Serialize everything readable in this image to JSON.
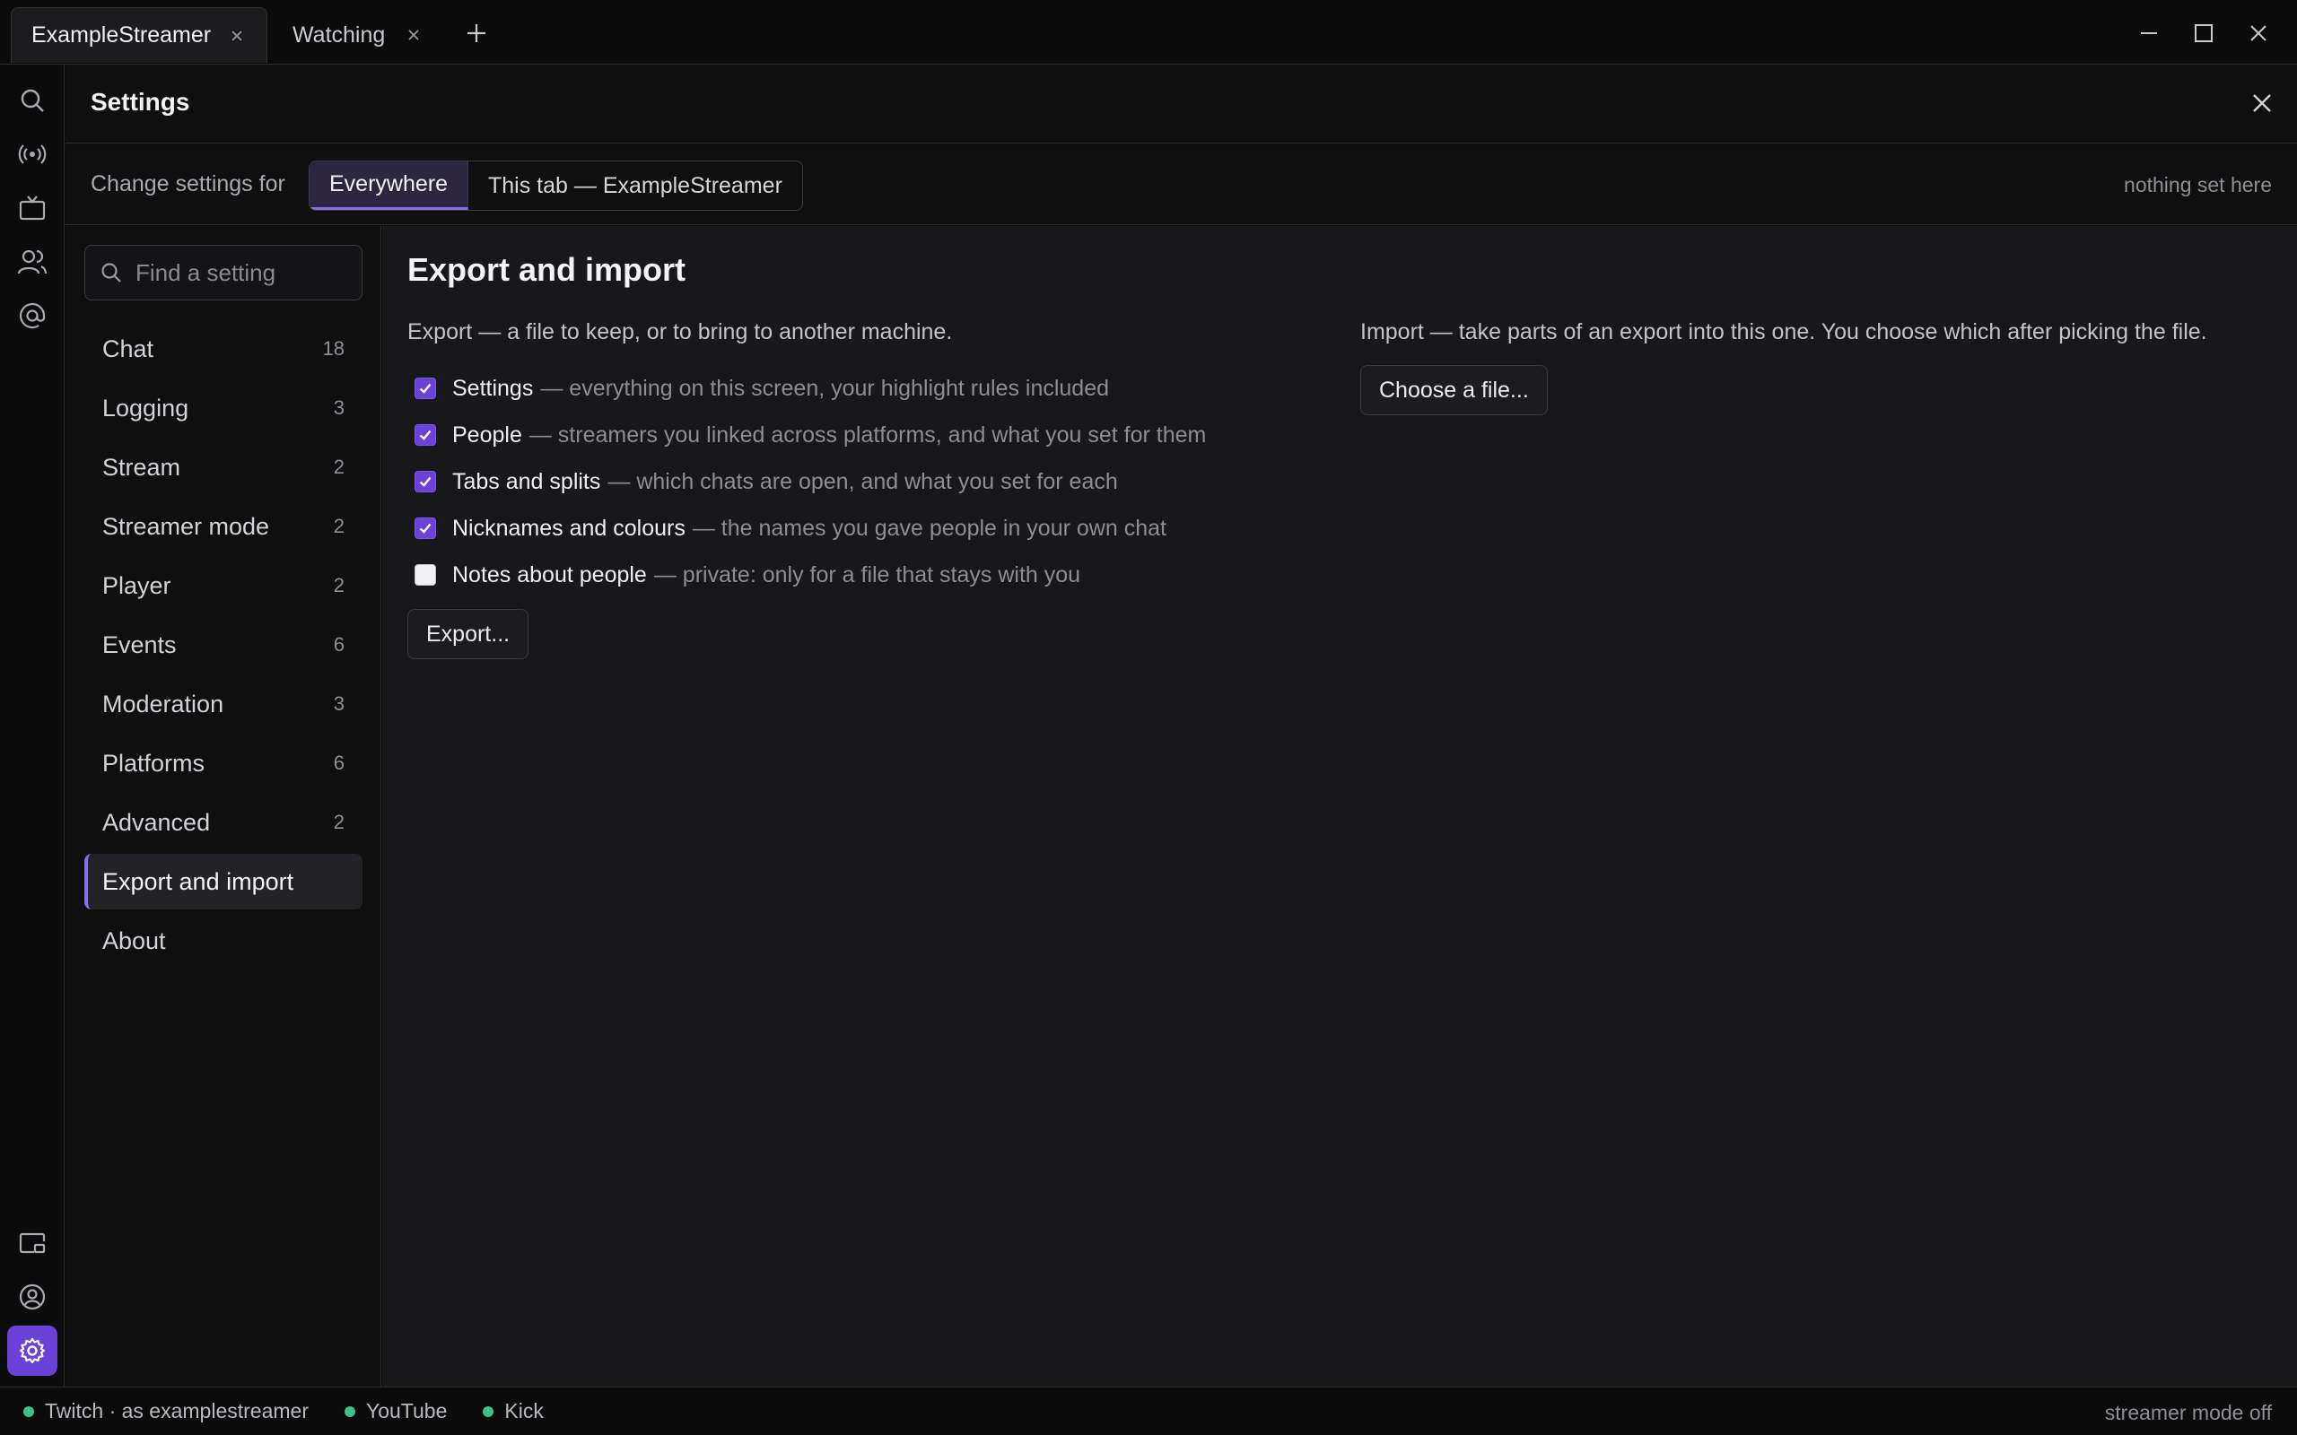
{
  "colors": {
    "accent": "#6a42d8",
    "accent_light": "#8b6df0",
    "online": "#3fbf8a"
  },
  "tabs": [
    {
      "label": "ExampleStreamer"
    },
    {
      "label": "Watching"
    }
  ],
  "settings": {
    "title": "Settings",
    "scope_label": "Change settings for",
    "scope_options": [
      "Everywhere",
      "This tab — ExampleStreamer"
    ],
    "scope_selected": "Everywhere",
    "scope_note": "nothing set here",
    "search_placeholder": "Find a setting"
  },
  "nav": [
    {
      "label": "Chat",
      "count": "18"
    },
    {
      "label": "Logging",
      "count": "3"
    },
    {
      "label": "Stream",
      "count": "2"
    },
    {
      "label": "Streamer mode",
      "count": "2"
    },
    {
      "label": "Player",
      "count": "2"
    },
    {
      "label": "Events",
      "count": "6"
    },
    {
      "label": "Moderation",
      "count": "3"
    },
    {
      "label": "Platforms",
      "count": "6"
    },
    {
      "label": "Advanced",
      "count": "2"
    },
    {
      "label": "Export and import",
      "count": "",
      "active": true
    },
    {
      "label": "About",
      "count": ""
    }
  ],
  "page": {
    "title": "Export and import",
    "export_intro": "Export — a file to keep, or to bring to another machine.",
    "export_items": [
      {
        "title": "Settings",
        "desc": "— everything on this screen, your highlight rules included",
        "checked": true
      },
      {
        "title": "People",
        "desc": "— streamers you linked across platforms, and what you set for them",
        "checked": true
      },
      {
        "title": "Tabs and splits",
        "desc": "— which chats are open, and what you set for each",
        "checked": true
      },
      {
        "title": "Nicknames and colours",
        "desc": "— the names you gave people in your own chat",
        "checked": true
      },
      {
        "title": "Notes about people",
        "desc": "— private: only for a file that stays with you",
        "checked": false
      }
    ],
    "export_button": "Export...",
    "import_intro": "Import — take parts of an export into this one. You choose which after picking the file.",
    "import_button": "Choose a file..."
  },
  "status": {
    "platforms": [
      {
        "label": "Twitch · as examplestreamer"
      },
      {
        "label": "YouTube"
      },
      {
        "label": "Kick"
      }
    ],
    "streamer_mode": "streamer mode off"
  },
  "icons": {
    "rail_top": [
      "search-icon",
      "broadcast-icon",
      "tv-icon",
      "users-icon",
      "at-icon"
    ],
    "rail_bottom": [
      "picture-in-picture-icon",
      "account-icon",
      "gear-icon"
    ]
  }
}
